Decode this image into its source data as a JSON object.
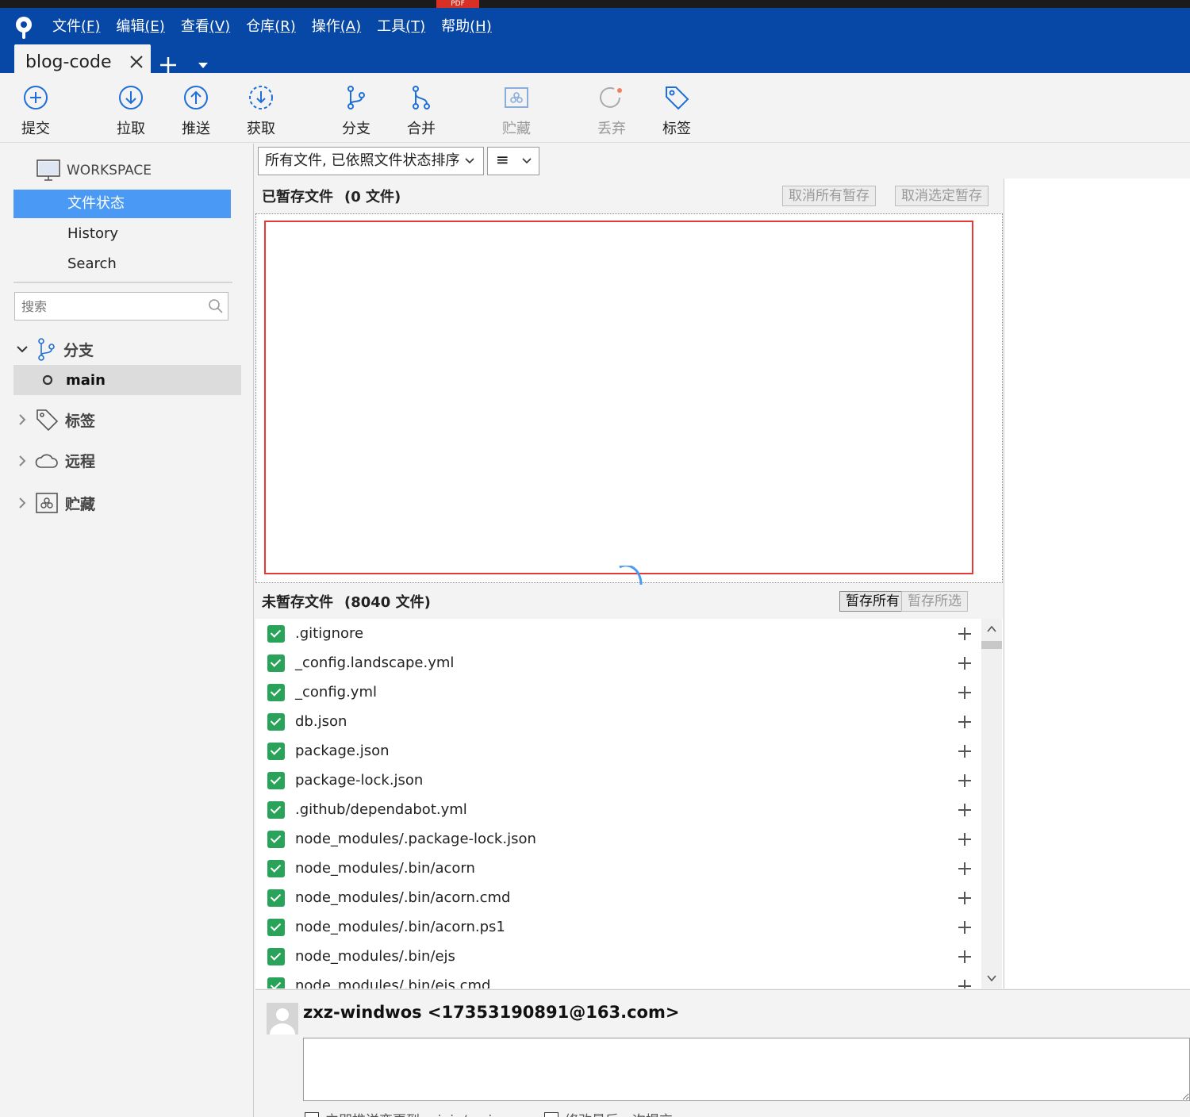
{
  "window": {
    "pdf_tab": "PDF",
    "menu": [
      {
        "label": "文件",
        "mnemonic": "(F)"
      },
      {
        "label": "编辑",
        "mnemonic": "(E)"
      },
      {
        "label": "查看",
        "mnemonic": "(V)"
      },
      {
        "label": "仓库",
        "mnemonic": "(R)"
      },
      {
        "label": "操作",
        "mnemonic": "(A)"
      },
      {
        "label": "工具",
        "mnemonic": "(T)"
      },
      {
        "label": "帮助",
        "mnemonic": "(H)"
      }
    ],
    "tab_title": "blog-code"
  },
  "toolbar": {
    "commit": "提交",
    "pull": "拉取",
    "push": "推送",
    "fetch": "获取",
    "branch": "分支",
    "merge": "合并",
    "stash": "贮藏",
    "discard": "丢弃",
    "tag": "标签"
  },
  "sidebar": {
    "workspace": "WORKSPACE",
    "items": [
      "文件状态",
      "History",
      "Search"
    ],
    "search_placeholder": "搜索",
    "branches_label": "分支",
    "current_branch": "main",
    "tags_label": "标签",
    "remotes_label": "远程",
    "stashes_label": "贮藏"
  },
  "filter": {
    "selected": "所有文件, 已依照文件状态排序",
    "view_icon": "≡"
  },
  "staged": {
    "title": "已暂存文件",
    "count": "(0 文件)",
    "unstage_all": "取消所有暂存",
    "unstage_selected": "取消选定暂存"
  },
  "unstaged": {
    "title": "未暂存文件",
    "count": "(8040 文件)",
    "stage_all": "暂存所有",
    "stage_selected": "暂存所选",
    "files": [
      ".gitignore",
      "_config.landscape.yml",
      "_config.yml",
      "db.json",
      "package.json",
      "package-lock.json",
      ".github/dependabot.yml",
      "node_modules/.package-lock.json",
      "node_modules/.bin/acorn",
      "node_modules/.bin/acorn.cmd",
      "node_modules/.bin/acorn.ps1",
      "node_modules/.bin/ejs",
      "node_modules/.bin/ejs.cmd"
    ]
  },
  "commit": {
    "author": "zxz-windwos <17353190891@163.com>",
    "push_option": "立即推送变更到 origin/main",
    "amend_option": "修改最后一次提交"
  },
  "colors": {
    "titlebar": "#0747a6",
    "selection": "#4a9af5",
    "checkbox": "#29a35a",
    "highlight_box": "#e53935"
  }
}
